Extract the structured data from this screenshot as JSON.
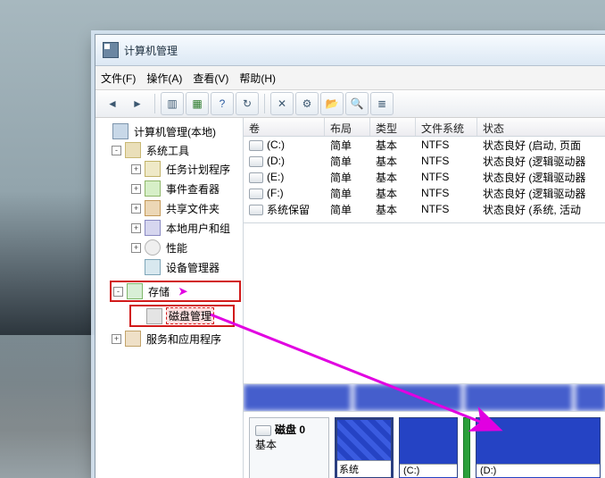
{
  "window": {
    "title": "计算机管理"
  },
  "menu": {
    "file": "文件(F)",
    "action": "操作(A)",
    "view": "查看(V)",
    "help": "帮助(H)"
  },
  "tree": {
    "root": "计算机管理(本地)",
    "system_tools": "系统工具",
    "task_scheduler": "任务计划程序",
    "event_viewer": "事件查看器",
    "shared_folders": "共享文件夹",
    "local_users": "本地用户和组",
    "performance": "性能",
    "device_manager": "设备管理器",
    "storage": "存储",
    "disk_management": "磁盘管理",
    "services_apps": "服务和应用程序"
  },
  "grid": {
    "headers": {
      "volume": "卷",
      "layout": "布局",
      "type": "类型",
      "fs": "文件系统",
      "status": "状态"
    },
    "rows": [
      {
        "vol": "(C:)",
        "layout": "简单",
        "type": "基本",
        "fs": "NTFS",
        "status": "状态良好 (启动, 页面"
      },
      {
        "vol": "(D:)",
        "layout": "简单",
        "type": "基本",
        "fs": "NTFS",
        "status": "状态良好 (逻辑驱动器"
      },
      {
        "vol": "(E:)",
        "layout": "简单",
        "type": "基本",
        "fs": "NTFS",
        "status": "状态良好 (逻辑驱动器"
      },
      {
        "vol": "(F:)",
        "layout": "简单",
        "type": "基本",
        "fs": "NTFS",
        "status": "状态良好 (逻辑驱动器"
      },
      {
        "vol": "系统保留",
        "layout": "简单",
        "type": "基本",
        "fs": "NTFS",
        "status": "状态良好 (系统, 活动"
      }
    ]
  },
  "disk": {
    "label": "磁盘 0",
    "kind": "基本",
    "partitions": [
      {
        "name": "系统"
      },
      {
        "name": "(C:)"
      },
      {
        "name": "(D:)"
      }
    ]
  }
}
